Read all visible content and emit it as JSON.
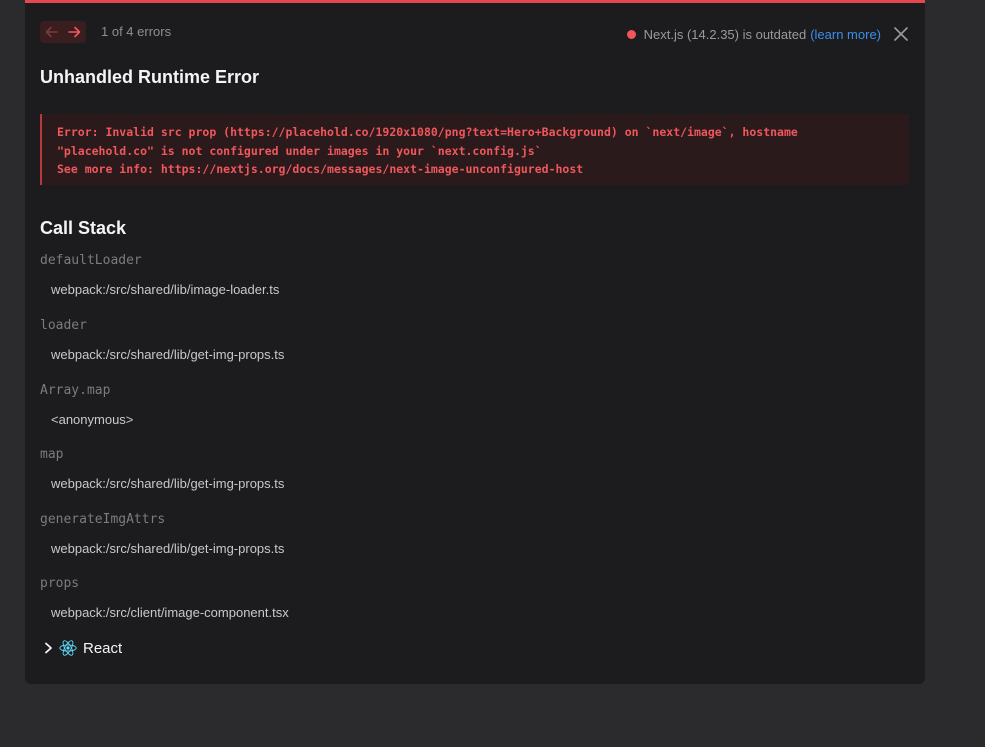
{
  "header": {
    "error_count": "1 of 4 errors",
    "version_text": "Next.js (14.2.35) is outdated",
    "learn_more": "(learn more)"
  },
  "error": {
    "title": "Unhandled Runtime Error",
    "lines": [
      "Error: Invalid src prop (https://placehold.co/1920x1080/png?text=Hero+Background) on `next/image`, hostname",
      "\"placehold.co\" is not configured under images in your `next.config.js`",
      "See more info: https://nextjs.org/docs/messages/next-image-unconfigured-host"
    ]
  },
  "call_stack": {
    "title": "Call Stack",
    "frames": [
      {
        "fn": "defaultLoader",
        "file": "webpack:/src/shared/lib/image-loader.ts"
      },
      {
        "fn": "loader",
        "file": "webpack:/src/shared/lib/get-img-props.ts"
      },
      {
        "fn": "Array.map",
        "file": "<anonymous>"
      },
      {
        "fn": "map",
        "file": "webpack:/src/shared/lib/get-img-props.ts"
      },
      {
        "fn": "generateImgAttrs",
        "file": "webpack:/src/shared/lib/get-img-props.ts"
      },
      {
        "fn": "props",
        "file": "webpack:/src/client/image-component.tsx"
      }
    ],
    "react_label": "React"
  },
  "colors": {
    "accent_error": "#e5484d",
    "link": "#3b8eea",
    "react": "#61dafb"
  }
}
